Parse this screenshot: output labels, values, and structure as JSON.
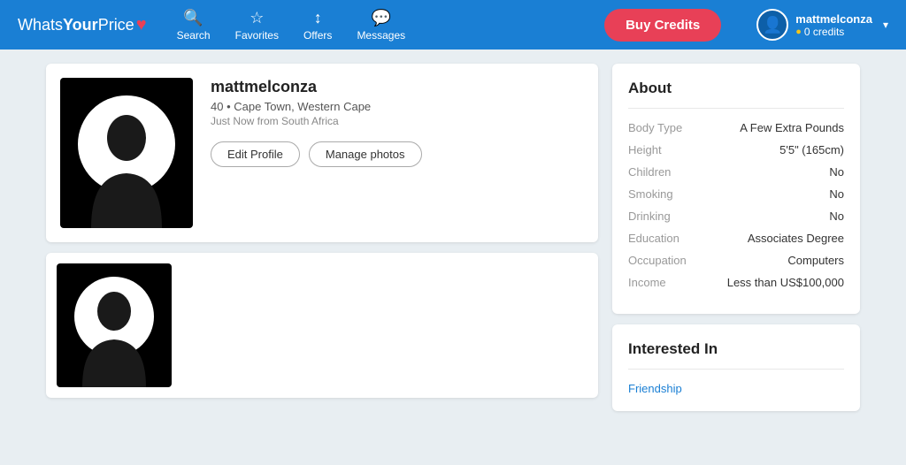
{
  "nav": {
    "logo_normal": "Whats",
    "logo_bold": "Your",
    "logo_price": "Price",
    "search_label": "Search",
    "favorites_label": "Favorites",
    "offers_label": "Offers",
    "messages_label": "Messages",
    "buy_credits_label": "Buy Credits",
    "username": "mattmelconza",
    "credits_label": "0 credits"
  },
  "profile": {
    "username": "mattmelconza",
    "age": "40",
    "location": "Cape Town, Western Cape",
    "status": "Just Now from South Africa",
    "edit_btn": "Edit Profile",
    "manage_photos_btn": "Manage photos"
  },
  "about": {
    "title": "About",
    "rows": [
      {
        "label": "Body Type",
        "value": "A Few Extra Pounds"
      },
      {
        "label": "Height",
        "value": "5'5\" (165cm)"
      },
      {
        "label": "Children",
        "value": "No"
      },
      {
        "label": "Smoking",
        "value": "No"
      },
      {
        "label": "Drinking",
        "value": "No"
      },
      {
        "label": "Education",
        "value": "Associates Degree"
      },
      {
        "label": "Occupation",
        "value": "Computers"
      },
      {
        "label": "Income",
        "value": "Less than US$100,000"
      }
    ]
  },
  "interested": {
    "title": "Interested In",
    "items": [
      "Friendship"
    ]
  }
}
